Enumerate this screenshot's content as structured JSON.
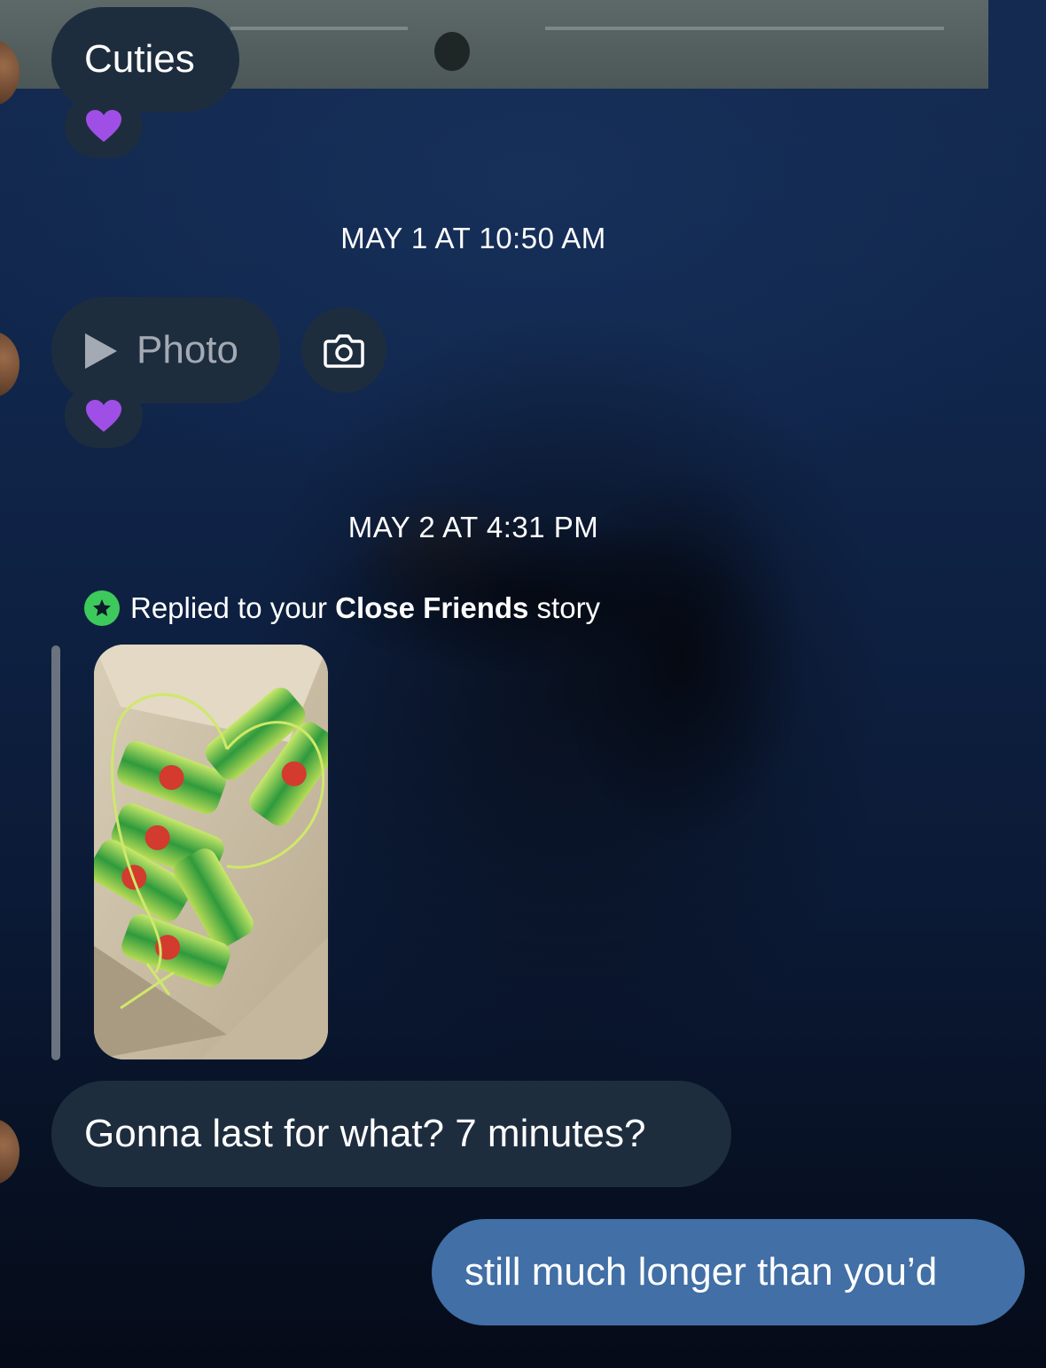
{
  "messages": {
    "m1": {
      "text": "Cuties",
      "reaction": "💜"
    },
    "ts1": "MAY 1 AT 10:50 AM",
    "m2": {
      "text": "Photo",
      "reaction": "💜"
    },
    "ts2": "MAY 2 AT 4:31 PM",
    "reply": {
      "prefix": "Replied to your ",
      "bold": "Close Friends",
      "suffix": " story"
    },
    "m3": {
      "text": "Gonna last for what? 7 minutes?"
    },
    "m4": {
      "text": "still much longer than you’d"
    }
  },
  "icons": {
    "play": "play-icon",
    "camera": "camera-icon",
    "star": "star-icon",
    "avatar": "avatar"
  },
  "colors": {
    "received_bubble": "#1e2d3e",
    "sent_bubble": "#416fa6",
    "close_friends_green": "#3ec95c",
    "photo_text": "#a3aab4"
  }
}
